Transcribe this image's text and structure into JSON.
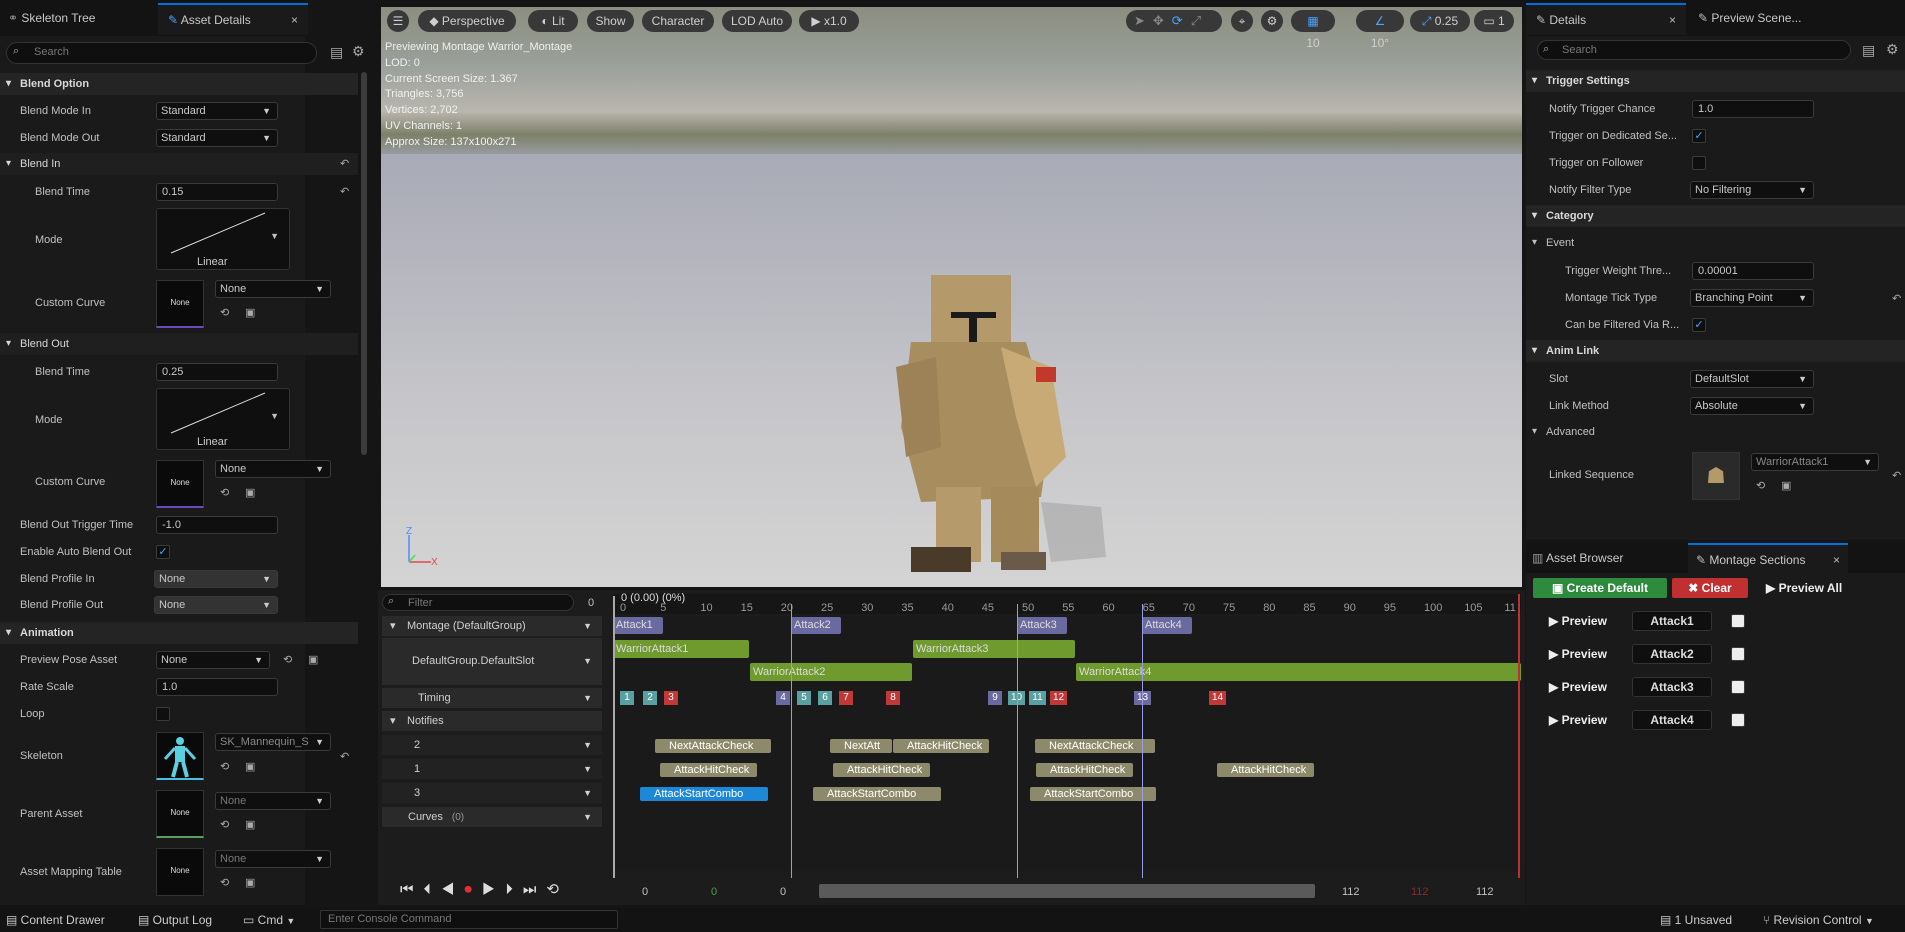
{
  "left_tabs": {
    "skeleton_tree": "Skeleton Tree",
    "asset_details": "Asset Details",
    "close": "×"
  },
  "search": {
    "placeholder": "Search"
  },
  "blend_option": {
    "header": "Blend Option",
    "mode_in_label": "Blend Mode In",
    "mode_in": "Standard",
    "mode_out_label": "Blend Mode Out",
    "mode_out": "Standard"
  },
  "blend_in": {
    "header": "Blend In",
    "time_label": "Blend Time",
    "time": "0.15",
    "mode_label": "Mode",
    "mode": "Linear",
    "curve_label": "Custom Curve",
    "curve_thumb": "None",
    "curve": "None"
  },
  "blend_out": {
    "header": "Blend Out",
    "time_label": "Blend Time",
    "time": "0.25",
    "mode_label": "Mode",
    "mode": "Linear",
    "curve_label": "Custom Curve",
    "curve_thumb": "None",
    "curve": "None"
  },
  "misc": {
    "trigger_label": "Blend Out Trigger Time",
    "trigger": "-1.0",
    "auto_label": "Enable Auto Blend Out",
    "profile_in_label": "Blend Profile In",
    "profile_in": "None",
    "profile_out_label": "Blend Profile Out",
    "profile_out": "None"
  },
  "animation": {
    "header": "Animation",
    "pose_label": "Preview Pose Asset",
    "pose": "None",
    "rate_label": "Rate Scale",
    "rate": "1.0",
    "loop_label": "Loop",
    "skeleton_label": "Skeleton",
    "skeleton": "SK_Mannequin_S",
    "parent_label": "Parent Asset",
    "parent_thumb": "None",
    "parent": "None",
    "mapping_label": "Asset Mapping Table",
    "mapping_thumb": "None",
    "mapping": "None"
  },
  "viewport": {
    "perspective": "Perspective",
    "lit": "Lit",
    "show": "Show",
    "character": "Character",
    "lod": "LOD Auto",
    "speed": "x1.0",
    "grid": "10",
    "angle": "10°",
    "scale": "0.25",
    "cam": "1",
    "info": [
      "Previewing Montage Warrior_Montage",
      "LOD: 0",
      "Current Screen Size: 1.367",
      "Triangles: 3,756",
      "Vertices: 2,702",
      "UV Channels: 1",
      "Approx Size: 137x100x271"
    ]
  },
  "timeline": {
    "filter_placeholder": "Filter",
    "filter_count": "0",
    "time_label": "0 (0.00) (0%)",
    "ticks": [
      "0",
      "5",
      "10",
      "15",
      "20",
      "25",
      "30",
      "35",
      "40",
      "45",
      "50",
      "55",
      "60",
      "65",
      "70",
      "75",
      "80",
      "85",
      "90",
      "95",
      "100",
      "105",
      "11"
    ],
    "montage_track": "Montage (DefaultGroup)",
    "slot_track": "DefaultGroup.DefaultSlot",
    "timing_track": "Timing",
    "notifies_track": "Notifies",
    "n2": "2",
    "n1": "1",
    "n3": "3",
    "curves_track": "Curves",
    "curves_count": "(0)",
    "sections": [
      "Attack1",
      "Attack2",
      "Attack3",
      "Attack4"
    ],
    "slot_segments": [
      "WarriorAttack1",
      "WarriorAttack2",
      "WarriorAttack3",
      "WarriorAttack4"
    ],
    "timing": [
      "1",
      "2",
      "3",
      "4",
      "5",
      "6",
      "7",
      "8",
      "9",
      "10",
      "11",
      "12",
      "13",
      "14"
    ],
    "notifies_row2": [
      "NextAttackCheck",
      "NextAtt",
      "AttackHitCheck",
      "NextAttackCheck"
    ],
    "notifies_row1": [
      "AttackHitCheck",
      "AttackHitCheck",
      "AttackHitCheck",
      "AttackHitCheck"
    ],
    "notifies_row3": [
      "AttackStartCombo",
      "AttackStartCombo",
      "AttackStartCombo"
    ],
    "transport": {
      "start": "0",
      "start_green": "0",
      "cursor": "0",
      "end": "112",
      "end_red": "112",
      "end2": "112"
    }
  },
  "details": {
    "tab": "Details",
    "preview_tab": "Preview Scene...",
    "trigger_header": "Trigger Settings",
    "chance_label": "Notify Trigger Chance",
    "chance": "1.0",
    "dedicated_label": "Trigger on Dedicated Se...",
    "follower_label": "Trigger on Follower",
    "filter_label": "Notify Filter Type",
    "filter": "No Filtering",
    "category_header": "Category",
    "event_header": "Event",
    "weight_label": "Trigger Weight Thre...",
    "weight": "0.00001",
    "tick_label": "Montage Tick Type",
    "tick": "Branching Point",
    "filtered_label": "Can be Filtered Via R...",
    "anim_link_header": "Anim Link",
    "slot_label": "Slot",
    "slot": "DefaultSlot",
    "link_label": "Link Method",
    "link": "Absolute",
    "advanced_header": "Advanced",
    "linked_label": "Linked Sequence",
    "linked": "WarriorAttack1"
  },
  "montage_sections": {
    "asset_browser_tab": "Asset Browser",
    "tab": "Montage Sections",
    "create": "Create Default",
    "clear": "Clear",
    "preview_all": "Preview All",
    "preview": "Preview",
    "rows": [
      "Attack1",
      "Attack2",
      "Attack3",
      "Attack4"
    ]
  },
  "statusbar": {
    "content": "Content Drawer",
    "output": "Output Log",
    "cmd": "Cmd",
    "console_placeholder": "Enter Console Command",
    "unsaved": "1 Unsaved",
    "revision": "Revision Control"
  },
  "colors": {
    "accent": "#0070e0",
    "section": "#6a6aa0",
    "slot": "#6f9a2e",
    "notify": "#8c8a6a",
    "create": "#2e8b3e",
    "clear": "#c03030"
  }
}
